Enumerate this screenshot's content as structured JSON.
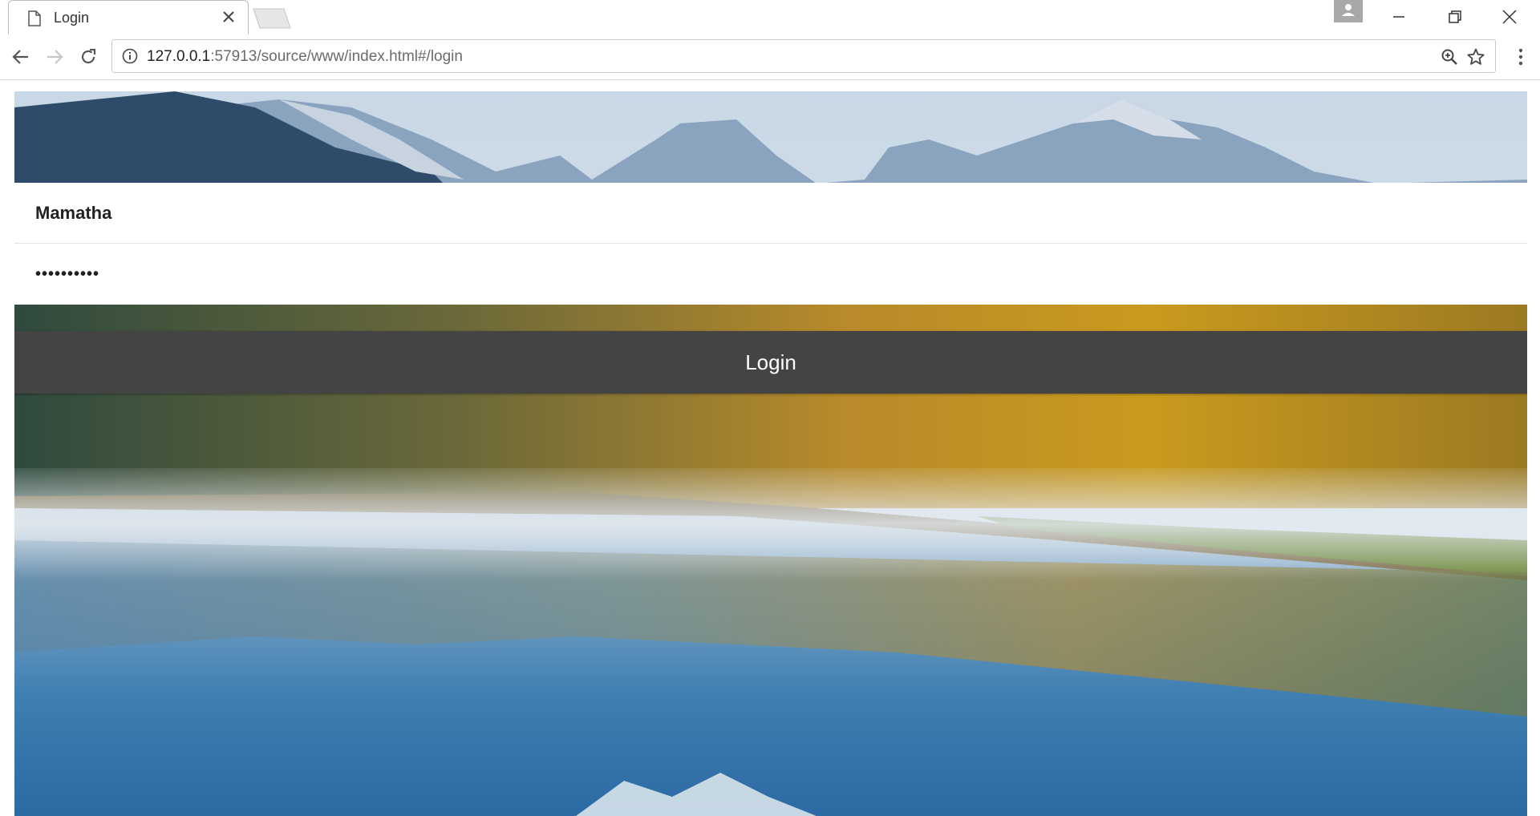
{
  "browser": {
    "tab_title": "Login",
    "url_host": "127.0.0.1",
    "url_rest": ":57913/source/www/index.html#/login"
  },
  "icons": {
    "tab": "document-icon",
    "close": "close-icon",
    "back": "back-arrow-icon",
    "forward": "forward-arrow-icon",
    "reload": "reload-icon",
    "info": "info-icon",
    "zoom": "zoom-icon",
    "bookmark": "star-icon",
    "menu": "kebab-menu-icon",
    "profile": "profile-icon"
  },
  "login": {
    "username_value": "Mamatha",
    "password_value": "**********",
    "button_label": "Login"
  },
  "colors": {
    "button_bg": "#444444",
    "button_text": "#ffffff"
  }
}
